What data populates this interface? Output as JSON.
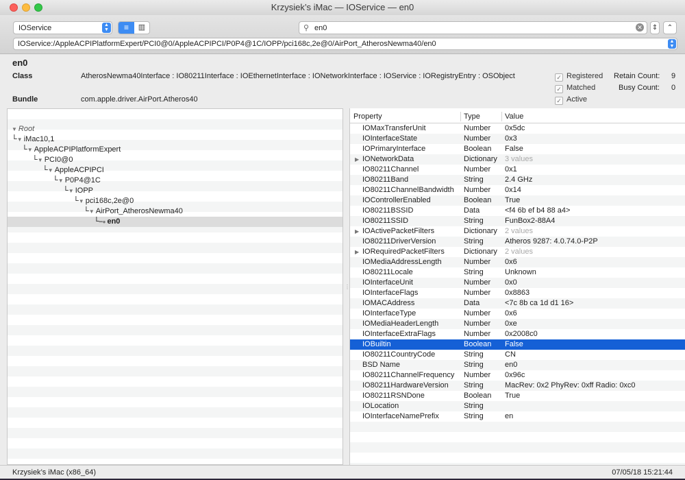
{
  "window": {
    "title": "Krzysiek’s iMac — IOService — en0"
  },
  "toolbar": {
    "plane": "IOService",
    "search_value": "en0",
    "path": "IOService:/AppleACPIPlatformExpert/PCI0@0/AppleACPIPCI/P0P4@1C/IOPP/pci168c,2e@0/AirPort_AtherosNewma40/en0"
  },
  "info": {
    "name": "en0",
    "class_label": "Class",
    "class_value": "AtherosNewma40Interface : IO80211Interface : IOEthernetInterface : IONetworkInterface : IOService : IORegistryEntry : OSObject",
    "bundle_label": "Bundle",
    "bundle_value": "com.apple.driver.AirPort.Atheros40",
    "registered": "Registered",
    "matched": "Matched",
    "active": "Active",
    "retain_label": "Retain Count:",
    "retain_value": "9",
    "busy_label": "Busy Count:",
    "busy_value": "0"
  },
  "tree": {
    "nodes": [
      {
        "label": "Root",
        "connector": "",
        "italic": true
      },
      {
        "label": "iMac10,1",
        "connector": "└"
      },
      {
        "label": "AppleACPIPlatformExpert",
        "connector": "└"
      },
      {
        "label": "PCI0@0",
        "connector": "└"
      },
      {
        "label": "AppleACPIPCI",
        "connector": "└"
      },
      {
        "label": "P0P4@1C",
        "connector": "└"
      },
      {
        "label": "IOPP",
        "connector": "└"
      },
      {
        "label": "pci168c,2e@0",
        "connector": "└"
      },
      {
        "label": "AirPort_AtherosNewma40",
        "connector": "└"
      },
      {
        "label": "en0",
        "connector": "└",
        "selected": true
      }
    ]
  },
  "properties": {
    "headers": {
      "property": "Property",
      "type": "Type",
      "value": "Value"
    },
    "rows": [
      {
        "name": "IOMaxTransferUnit",
        "type": "Number",
        "value": "0x5dc"
      },
      {
        "name": "IOInterfaceState",
        "type": "Number",
        "value": "0x3"
      },
      {
        "name": "IOPrimaryInterface",
        "type": "Boolean",
        "value": "False"
      },
      {
        "name": "IONetworkData",
        "type": "Dictionary",
        "value": "3 values",
        "expandable": true
      },
      {
        "name": "IO80211Channel",
        "type": "Number",
        "value": "0x1"
      },
      {
        "name": "IO80211Band",
        "type": "String",
        "value": "2.4 GHz"
      },
      {
        "name": "IO80211ChannelBandwidth",
        "type": "Number",
        "value": "0x14"
      },
      {
        "name": "IOControllerEnabled",
        "type": "Boolean",
        "value": "True"
      },
      {
        "name": "IO80211BSSID",
        "type": "Data",
        "value": "<f4 6b ef b4 88 a4>"
      },
      {
        "name": "IO80211SSID",
        "type": "String",
        "value": "FunBox2-88A4"
      },
      {
        "name": "IOActivePacketFilters",
        "type": "Dictionary",
        "value": "2 values",
        "expandable": true
      },
      {
        "name": "IO80211DriverVersion",
        "type": "String",
        "value": "Atheros 9287: 4.0.74.0-P2P"
      },
      {
        "name": "IORequiredPacketFilters",
        "type": "Dictionary",
        "value": "2 values",
        "expandable": true
      },
      {
        "name": "IOMediaAddressLength",
        "type": "Number",
        "value": "0x6"
      },
      {
        "name": "IO80211Locale",
        "type": "String",
        "value": "Unknown"
      },
      {
        "name": "IOInterfaceUnit",
        "type": "Number",
        "value": "0x0"
      },
      {
        "name": "IOInterfaceFlags",
        "type": "Number",
        "value": "0x8863"
      },
      {
        "name": "IOMACAddress",
        "type": "Data",
        "value": "<7c 8b ca 1d d1 16>"
      },
      {
        "name": "IOInterfaceType",
        "type": "Number",
        "value": "0x6"
      },
      {
        "name": "IOMediaHeaderLength",
        "type": "Number",
        "value": "0xe"
      },
      {
        "name": "IOInterfaceExtraFlags",
        "type": "Number",
        "value": "0x2008c0"
      },
      {
        "name": "IOBuiltin",
        "type": "Boolean",
        "value": "False",
        "selected": true
      },
      {
        "name": "IO80211CountryCode",
        "type": "String",
        "value": "CN"
      },
      {
        "name": "BSD Name",
        "type": "String",
        "value": "en0"
      },
      {
        "name": "IO80211ChannelFrequency",
        "type": "Number",
        "value": "0x96c"
      },
      {
        "name": "IO80211HardwareVersion",
        "type": "String",
        "value": "MacRev: 0x2 PhyRev: 0xff Radio: 0xc0"
      },
      {
        "name": "IO80211RSNDone",
        "type": "Boolean",
        "value": "True"
      },
      {
        "name": "IOLocation",
        "type": "String",
        "value": ""
      },
      {
        "name": "IOInterfaceNamePrefix",
        "type": "String",
        "value": "en"
      }
    ]
  },
  "status": {
    "machine": "Krzysiek’s iMac (x86_64)",
    "timestamp": "07/05/18 15:21:44"
  },
  "colors": {
    "accent": "#3d8cf3",
    "selection": "#1560d6"
  }
}
